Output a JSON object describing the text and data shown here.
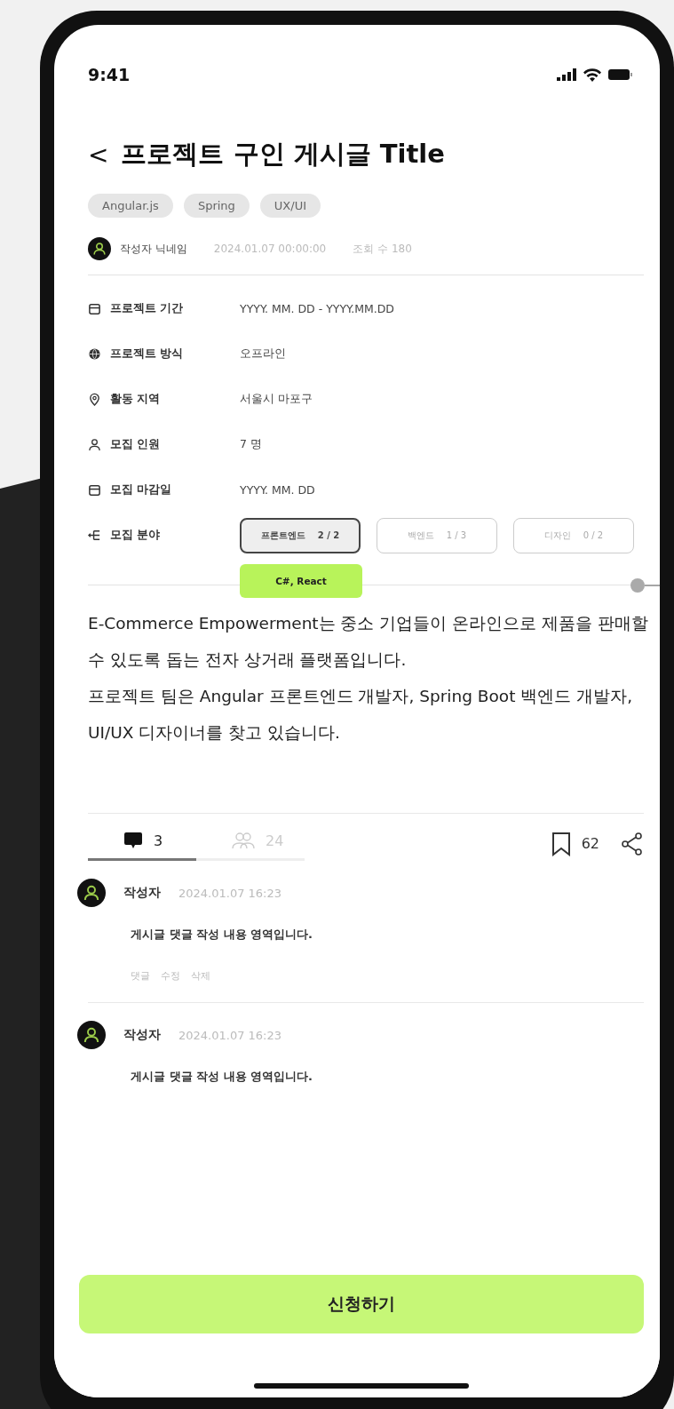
{
  "status_bar": {
    "time": "9:41"
  },
  "header": {
    "back": "<",
    "title": "프로젝트 구인 게시글 Title"
  },
  "tags": [
    "Angular.js",
    "Spring",
    "UX/UI"
  ],
  "author": {
    "name": "작성자 닉네임",
    "date": "2024.01.07 00:00:00",
    "views": "조회 수 180"
  },
  "details": [
    {
      "kind": "calendar",
      "label": "프로젝트 기간",
      "value": "YYYY. MM. DD - YYYY.MM.DD"
    },
    {
      "kind": "globe",
      "label": "프로젝트 방식",
      "value": "오프라인"
    },
    {
      "kind": "pin",
      "label": "활동 지역",
      "value": "서울시 마포구"
    },
    {
      "kind": "person",
      "label": "모집 인원",
      "value": "7 명"
    },
    {
      "kind": "calendar",
      "label": "모집 마감일",
      "value": "YYYY. MM. DD"
    },
    {
      "kind": "branch",
      "label": "모집 분야",
      "positions": [
        {
          "name": "프론트엔드",
          "count": "2 / 2",
          "selected": true,
          "tooltip": "C#, React"
        },
        {
          "name": "백엔드",
          "count": "1 / 3",
          "selected": false
        },
        {
          "name": "디자인",
          "count": "0 / 2",
          "selected": false
        }
      ]
    }
  ],
  "description": [
    "E-Commerce Empowerment는 중소 기업들이 온라인으로 제품을 판매할 수 있도록 돕는 전자 상거래 플랫폼입니다.",
    "프로젝트 팀은 Angular 프론트엔드 개발자, Spring Boot 백엔드 개발자, UI/UX 디자이너를 찾고 있습니다."
  ],
  "tabs": [
    {
      "kind": "comments",
      "count": "3",
      "selected": true
    },
    {
      "kind": "members",
      "count": "24",
      "selected": false
    }
  ],
  "bookmark_count": "62",
  "comments": [
    {
      "author": "작성자",
      "date": "2024.01.07 16:23",
      "body": "게시글 댓글 작성 내용 영역입니다.",
      "actions": [
        "댓글",
        "수정",
        "삭제"
      ]
    },
    {
      "author": "작성자",
      "date": "2024.01.07 16:23",
      "body": "게시글 댓글 작성 내용 영역입니다."
    }
  ],
  "apply_button": "신청하기"
}
